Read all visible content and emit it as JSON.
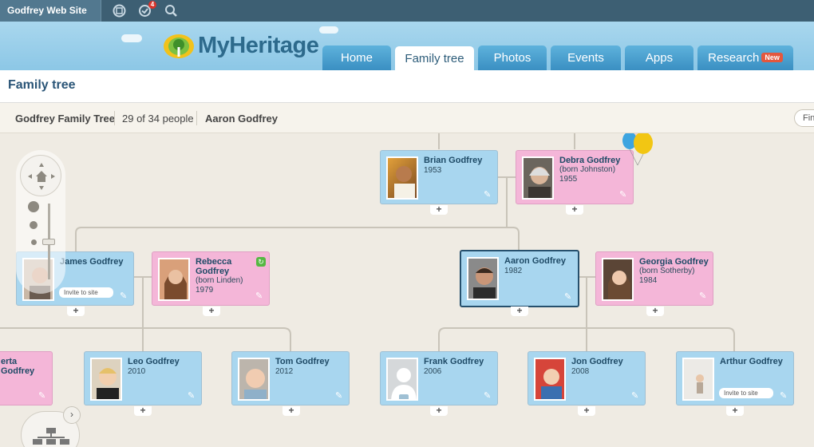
{
  "topbar": {
    "site": "Godfrey Web Site",
    "notifications": "4"
  },
  "logo": {
    "text": "MyHeritage"
  },
  "tabs": [
    {
      "label": "Home",
      "active": false
    },
    {
      "label": "Family tree",
      "active": true
    },
    {
      "label": "Photos",
      "active": false
    },
    {
      "label": "Events",
      "active": false
    },
    {
      "label": "Apps",
      "active": false
    },
    {
      "label": "Research",
      "active": false,
      "badge": "New"
    }
  ],
  "page_title": "Family tree",
  "subbar": {
    "tree_name": "Godfrey Family Tree",
    "count": "29 of 34 people",
    "root": "Aaron Godfrey",
    "find": "Fin"
  },
  "people": {
    "brian": {
      "name": "Brian Godfrey",
      "year": "1953"
    },
    "debra": {
      "name": "Debra Godfrey",
      "born": "(born Johnston)",
      "year": "1955"
    },
    "james": {
      "name": "James Godfrey",
      "invite": "Invite to site"
    },
    "rebecca": {
      "name_line1": "Rebecca",
      "name_line2": "Godfrey",
      "born": "(born Linden)",
      "year": "1979"
    },
    "aaron": {
      "name": "Aaron Godfrey",
      "year": "1982"
    },
    "georgia": {
      "name": "Georgia Godfrey",
      "born": "(born Sotherby)",
      "year": "1984"
    },
    "berta": {
      "name": "erta Godfrey"
    },
    "leo": {
      "name": "Leo Godfrey",
      "year": "2010"
    },
    "tom": {
      "name": "Tom Godfrey",
      "year": "2012"
    },
    "frank": {
      "name": "Frank Godfrey",
      "year": "2006"
    },
    "jon": {
      "name": "Jon Godfrey",
      "year": "2008"
    },
    "arthur": {
      "name": "Arthur Godfrey",
      "invite": "Invite to site"
    }
  },
  "colors": {
    "male": "#a8d6ef",
    "female": "#f4b6d8",
    "accent": "#2a5577"
  }
}
